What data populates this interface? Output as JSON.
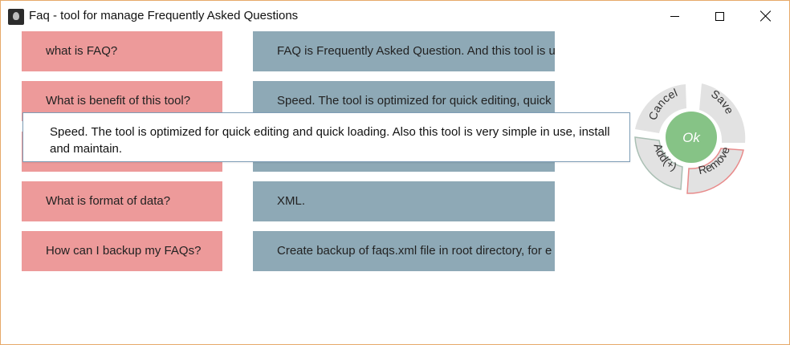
{
  "window": {
    "title": "Faq - tool for manage Frequently Asked Questions"
  },
  "faqs": [
    {
      "question": "what is FAQ?",
      "answer": "FAQ is Frequently Asked Question. And this tool is us"
    },
    {
      "question": "What is benefit of this tool?",
      "answer": "Speed. The tool is optimized for quick editing, quick"
    },
    {
      "question": "",
      "answer": ""
    },
    {
      "question": "What is format of data?",
      "answer": "XML."
    },
    {
      "question": "How can I backup my FAQs?",
      "answer": "Create backup of faqs.xml file in root directory, for e"
    }
  ],
  "tooltip": {
    "text": "Speed. The tool is optimized for quick editing and quick loading. Also this tool is very simple in use, install and maintain."
  },
  "action_wheel": {
    "cancel_label": "Cancel",
    "save_label": "Save",
    "add_label": "Add(+)",
    "remove_label": "Remove",
    "ok_label": "Ok",
    "colors": {
      "segment": "#e2e2e2",
      "add_border": "#a9bfb3",
      "remove_border": "#e88a8a",
      "ok": "#86c386"
    }
  }
}
